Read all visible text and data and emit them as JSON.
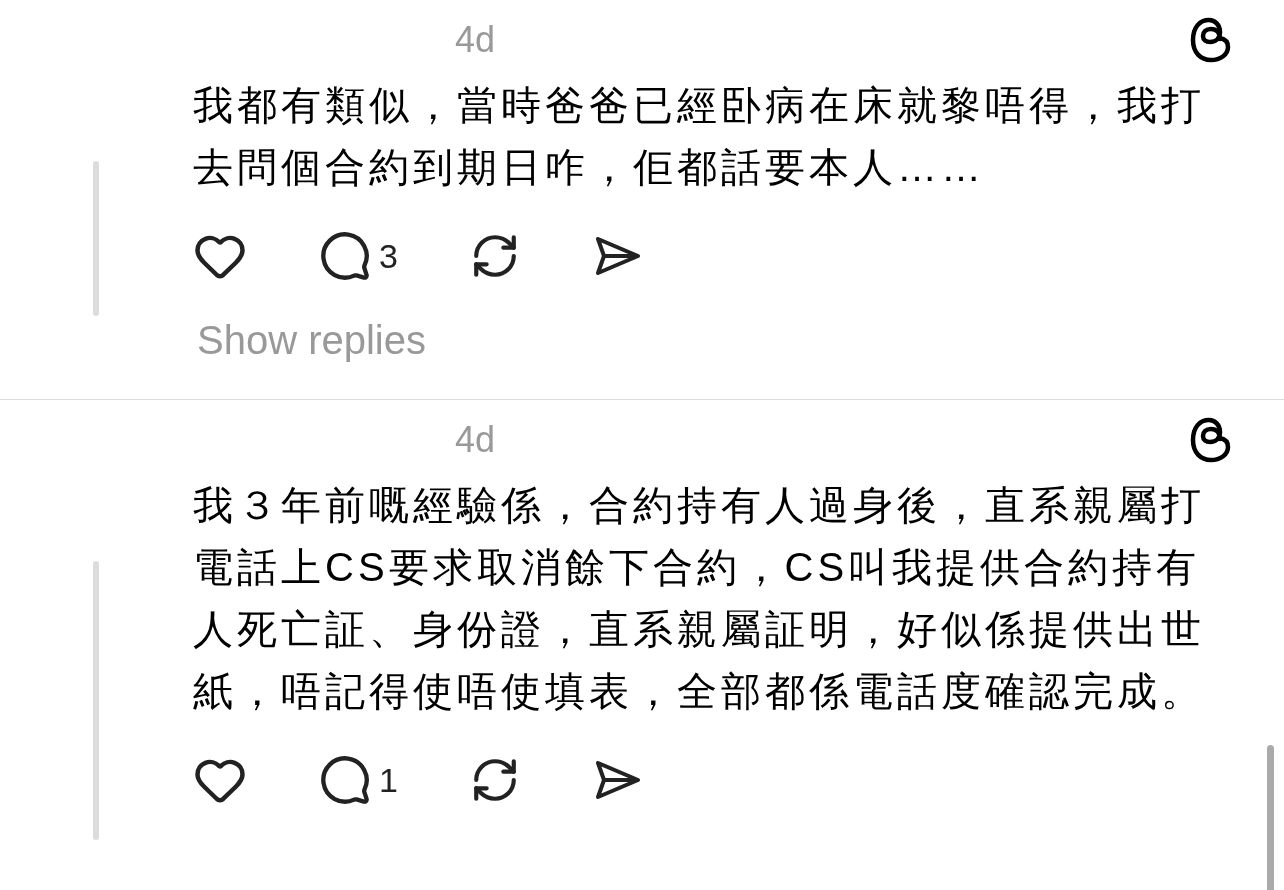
{
  "posts": [
    {
      "time": "4d",
      "text": "我都有類似，當時爸爸已經卧病在床就黎唔得，我打去問個合約到期日咋，佢都話要本人……",
      "reply_count": "3",
      "show_replies": "Show replies"
    },
    {
      "time": "4d",
      "text": "我３年前嘅經驗係，合約持有人過身後，直系親屬打電話上CS要求取消餘下合約，CS叫我提供合約持有人死亡証、身份證，直系親屬証明，好似係提供出世紙，唔記得使唔使填表，全部都係電話度確認完成。",
      "reply_count": "1"
    }
  ]
}
